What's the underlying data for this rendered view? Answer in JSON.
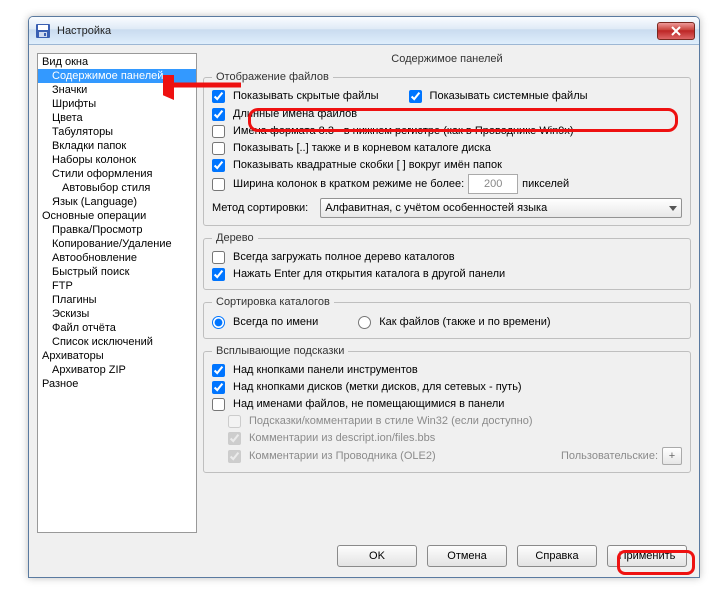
{
  "window": {
    "title": "Настройка"
  },
  "sidebar": {
    "items": [
      {
        "label": "Вид окна",
        "indent": 0
      },
      {
        "label": "Содержимое панелей",
        "indent": 1,
        "selected": true
      },
      {
        "label": "Значки",
        "indent": 1
      },
      {
        "label": "Шрифты",
        "indent": 1
      },
      {
        "label": "Цвета",
        "indent": 1
      },
      {
        "label": "Табуляторы",
        "indent": 1
      },
      {
        "label": "Вкладки папок",
        "indent": 1
      },
      {
        "label": "Наборы колонок",
        "indent": 1
      },
      {
        "label": "Стили оформления",
        "indent": 1
      },
      {
        "label": "Автовыбор стиля",
        "indent": 2
      },
      {
        "label": "Язык (Language)",
        "indent": 1
      },
      {
        "label": "Основные операции",
        "indent": 0
      },
      {
        "label": "Правка/Просмотр",
        "indent": 1
      },
      {
        "label": "Копирование/Удаление",
        "indent": 1
      },
      {
        "label": "Автообновление",
        "indent": 1
      },
      {
        "label": "Быстрый поиск",
        "indent": 1
      },
      {
        "label": "FTP",
        "indent": 1
      },
      {
        "label": "Плагины",
        "indent": 1
      },
      {
        "label": "Эскизы",
        "indent": 1
      },
      {
        "label": "Файл отчёта",
        "indent": 1
      },
      {
        "label": "Список исключений",
        "indent": 1
      },
      {
        "label": "Архиваторы",
        "indent": 0
      },
      {
        "label": "Архиватор ZIP",
        "indent": 1
      },
      {
        "label": "Разное",
        "indent": 0
      }
    ]
  },
  "main": {
    "title": "Содержимое панелей",
    "group_display": {
      "legend": "Отображение файлов",
      "cb_hidden": "Показывать скрытые файлы",
      "cb_system": "Показывать системные файлы",
      "cb_longnames": "Длинные имена файлов",
      "cb_83": "Имена формата 8.3 - в нижнем регистре (как в Проводнике Win9x)",
      "cb_dotdot": "Показывать [..] также и в корневом каталоге диска",
      "cb_brackets": "Показывать квадратные скобки [ ] вокруг имён папок",
      "row_width_before": "Ширина колонок в кратком режиме не более:",
      "row_width_value": "200",
      "row_width_after": "пикселей",
      "sort_label": "Метод сортировки:",
      "sort_value": "Алфавитная, с учётом особенностей языка"
    },
    "group_tree": {
      "legend": "Дерево",
      "cb_full": "Всегда загружать полное дерево каталогов",
      "cb_enter": "Нажать Enter для открытия каталога в другой панели"
    },
    "group_sort": {
      "legend": "Сортировка каталогов",
      "rb_name": "Всегда по имени",
      "rb_files": "Как файлов (также и по времени)"
    },
    "group_hints": {
      "legend": "Всплывающие подсказки",
      "cb_toolbar": "Над кнопками панели инструментов",
      "cb_drives": "Над кнопками дисков (метки дисков, для сетевых - путь)",
      "cb_filenames": "Над именами файлов, не помещающимися в панели",
      "cb_win32": "Подсказки/комментарии в стиле Win32 (если доступно)",
      "cb_descr": "Комментарии из descript.ion/files.bbs",
      "cb_ole2": "Комментарии из Проводника (OLE2)",
      "custom_label": "Пользовательские:",
      "plus": "+"
    }
  },
  "buttons": {
    "ok": "OK",
    "cancel": "Отмена",
    "help": "Справка",
    "apply": "Применить"
  }
}
